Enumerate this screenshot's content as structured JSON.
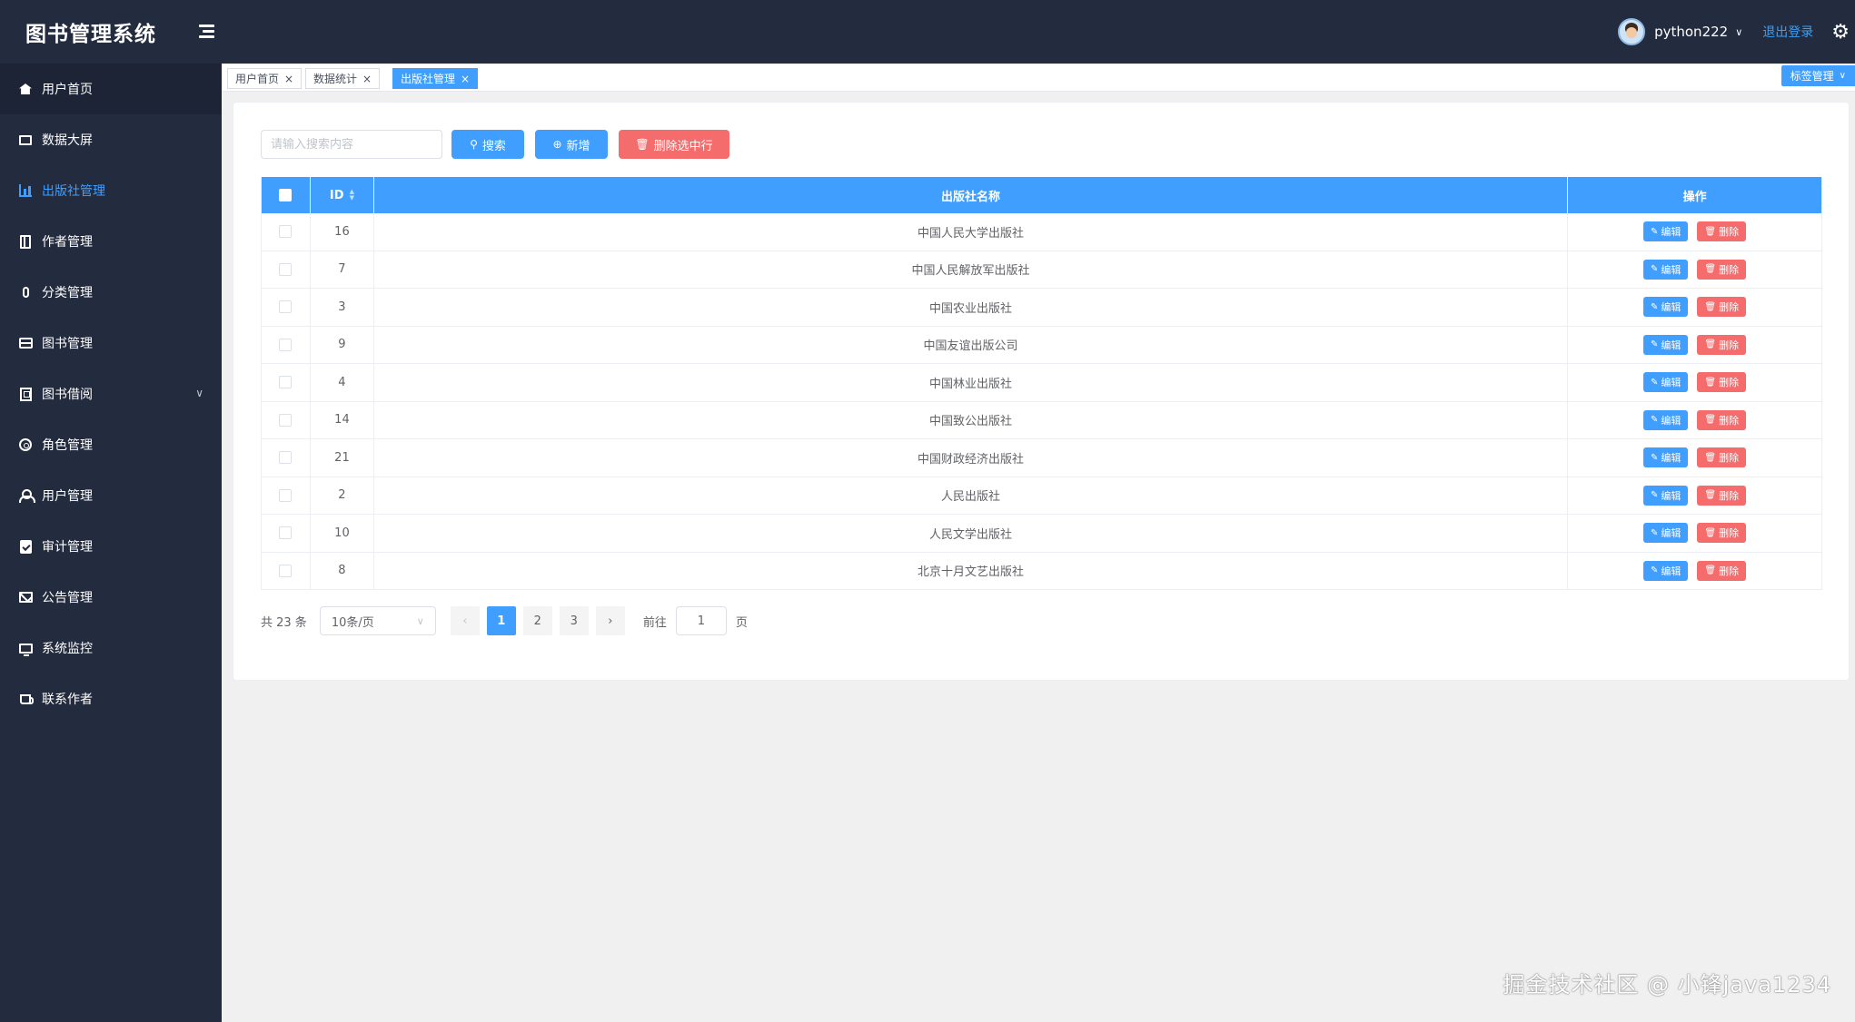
{
  "header": {
    "app_title": "图书管理系统",
    "username": "python222",
    "logout": "退出登录"
  },
  "sidebar": {
    "items": [
      {
        "label": "用户首页",
        "icon": "home-icon"
      },
      {
        "label": "数据大屏",
        "icon": "monitor-icon"
      },
      {
        "label": "出版社管理",
        "icon": "chart-icon",
        "active": true
      },
      {
        "label": "作者管理",
        "icon": "notebook-icon"
      },
      {
        "label": "分类管理",
        "icon": "microphone-icon"
      },
      {
        "label": "图书管理",
        "icon": "box-icon"
      },
      {
        "label": "图书借阅",
        "icon": "building-icon",
        "has_submenu": true
      },
      {
        "label": "角色管理",
        "icon": "gear-icon"
      },
      {
        "label": "用户管理",
        "icon": "user-icon"
      },
      {
        "label": "审计管理",
        "icon": "clipboard-check-icon"
      },
      {
        "label": "公告管理",
        "icon": "mail-icon"
      },
      {
        "label": "系统监控",
        "icon": "screen-icon"
      },
      {
        "label": "联系作者",
        "icon": "cup-icon"
      }
    ]
  },
  "tabs": {
    "items": [
      {
        "label": "用户首页"
      },
      {
        "label": "数据统计"
      },
      {
        "label": "出版社管理",
        "active": true
      }
    ],
    "manage_label": "标签管理"
  },
  "toolbar": {
    "search_placeholder": "请输入搜索内容",
    "search_label": "搜索",
    "add_label": "新增",
    "delete_selected_label": "删除选中行"
  },
  "table": {
    "columns": [
      "ID",
      "出版社名称",
      "操作"
    ],
    "edit_label": "编辑",
    "delete_label": "删除",
    "rows": [
      {
        "id": "16",
        "name": "中国人民大学出版社"
      },
      {
        "id": "7",
        "name": "中国人民解放军出版社"
      },
      {
        "id": "3",
        "name": "中国农业出版社"
      },
      {
        "id": "9",
        "name": "中国友谊出版公司"
      },
      {
        "id": "4",
        "name": "中国林业出版社"
      },
      {
        "id": "14",
        "name": "中国致公出版社"
      },
      {
        "id": "21",
        "name": "中国财政经济出版社"
      },
      {
        "id": "2",
        "name": "人民出版社"
      },
      {
        "id": "10",
        "name": "人民文学出版社"
      },
      {
        "id": "8",
        "name": "北京十月文艺出版社"
      }
    ]
  },
  "pagination": {
    "total_text": "共 23 条",
    "page_size": "10条/页",
    "pages": [
      "1",
      "2",
      "3"
    ],
    "current_page": "1",
    "goto_label": "前往",
    "goto_value": "1",
    "page_suffix": "页"
  },
  "watermark": "掘金技术社区 @ 小锋java1234",
  "colors": {
    "sidebar_bg": "#232b3f",
    "primary": "#409eff",
    "danger": "#f56c6c",
    "page_bg": "#f0f0f0"
  }
}
